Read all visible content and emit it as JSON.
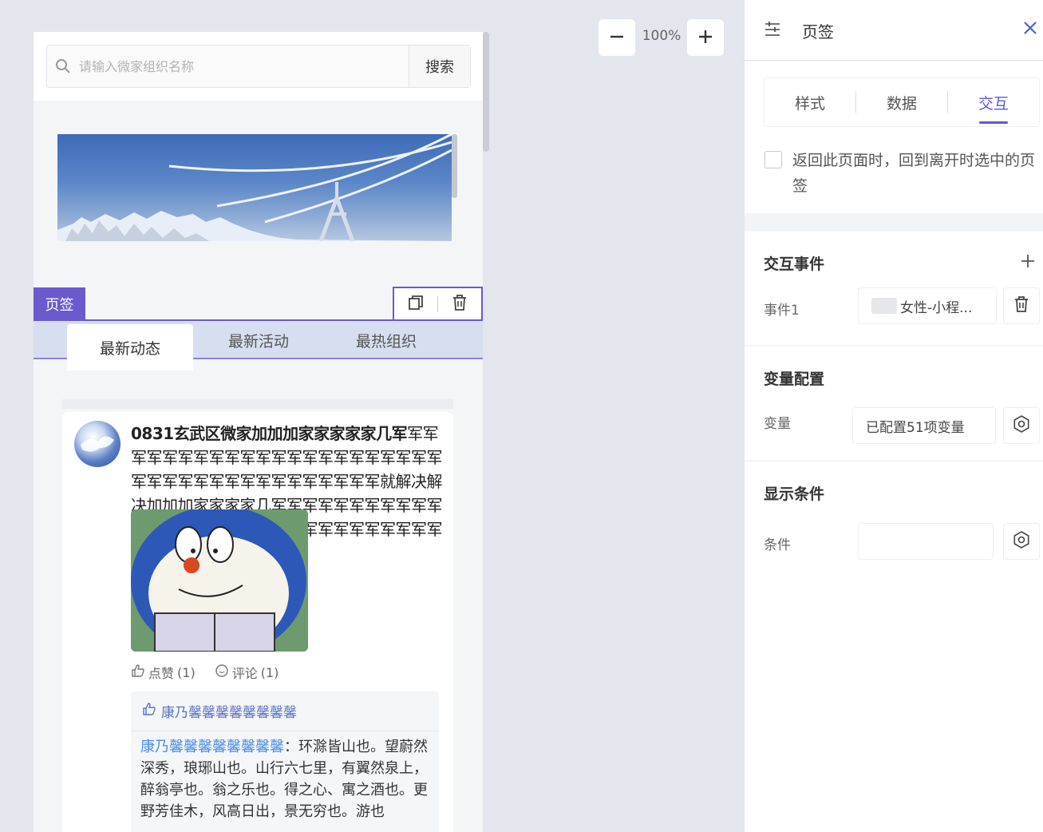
{
  "canvas": {
    "search": {
      "placeholder": "请输入微家组织名称",
      "button_label": "搜索"
    },
    "tab_component_label": "页签",
    "tabs": [
      {
        "label": "最新动态",
        "active": true
      },
      {
        "label": "最新活动",
        "active": false
      },
      {
        "label": "最热组织",
        "active": false
      }
    ],
    "post": {
      "title": "0831玄武区微家加加加家家家家家几军",
      "body": "军军军军军军军军军军军军军军军军军军军军军军军军军军军军军军军军军军军军军军就解决解决加加加家家家家几军军军军军军军军军军军军军军军军军军军军军军军军军军军军军军军",
      "actions": {
        "like_label": "点赞",
        "like_count": "(1)",
        "comment_label": "评论",
        "comment_count": "(1)"
      },
      "liked_by": "康乃馨馨馨馨馨馨馨馨",
      "comment": {
        "author": "康乃馨馨馨馨馨馨馨馨",
        "separator": "：",
        "text": "环滁皆山也。望蔚然深秀，琅琊山也。山行六七里，有翼然泉上，醉翁亭也。翁之乐也。得之心、寓之酒也。更野芳佳木，风高日出，景无穷也。游也"
      }
    }
  },
  "zoom": {
    "level": "100%"
  },
  "panel": {
    "title": "页签",
    "tabs": [
      {
        "label": "样式",
        "active": false
      },
      {
        "label": "数据",
        "active": false
      },
      {
        "label": "交互",
        "active": true
      }
    ],
    "return_option": {
      "checked": false,
      "label": "返回此页面时，回到离开时选中的页签"
    },
    "events": {
      "title": "交互事件",
      "items": [
        {
          "label": "事件1",
          "value": "女性-小程..."
        }
      ]
    },
    "variables": {
      "title": "变量配置",
      "label": "变量",
      "value": "已配置51项变量"
    },
    "condition": {
      "title": "显示条件",
      "label": "条件",
      "value": ""
    }
  },
  "colors": {
    "accent": "#6a5acd",
    "tab_active": "#5b5bd6",
    "link": "#4a8fe7",
    "panel_bg": "#f3f4f6",
    "canvas_bg": "#e3e6ec"
  }
}
